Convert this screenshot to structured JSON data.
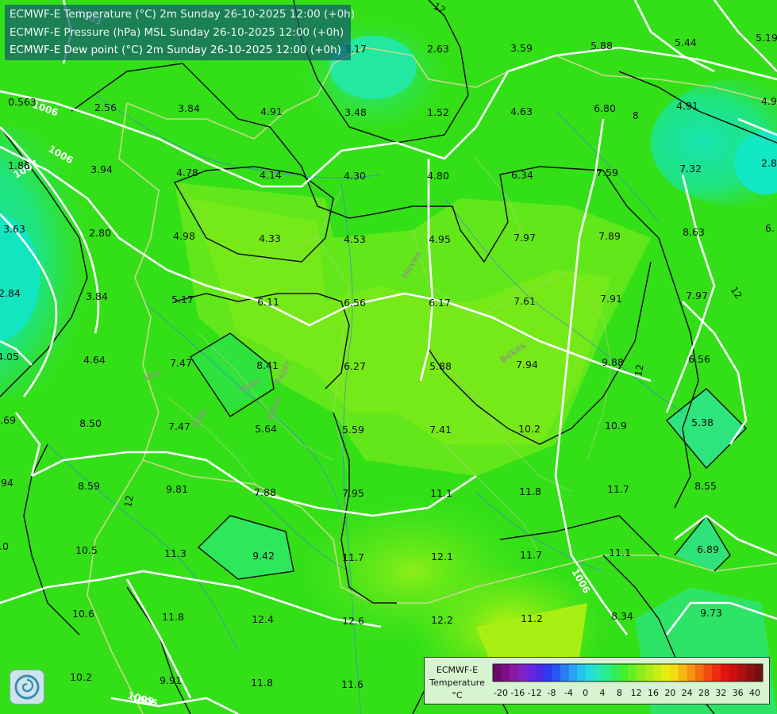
{
  "header": {
    "lines": [
      "ECMWF-E Temperature (°C) 2m Sunday 26-10-2025 12:00 (+0h)",
      "ECMWF-E Pressure (hPa) MSL Sunday 26-10-2025 12:00 (+0h)",
      "ECMWF-E Dew point (°C) 2m Sunday 26-10-2025 12:00 (+0h)"
    ]
  },
  "legend": {
    "title_lines": [
      "ECMWF-E",
      "Temperature",
      "°C"
    ],
    "ticks": [
      "-20",
      "-16",
      "-12",
      "-8",
      "-4",
      "0",
      "4",
      "8",
      "12",
      "16",
      "20",
      "24",
      "28",
      "32",
      "36",
      "40"
    ],
    "colors": [
      "#6a0a6a",
      "#7f0f86",
      "#8a1aa2",
      "#7e22c6",
      "#6a24dc",
      "#4c2ae6",
      "#2f38ee",
      "#2656f4",
      "#2a7cf6",
      "#2aa2f6",
      "#24c4ee",
      "#24dcd8",
      "#26e8b4",
      "#2aee8c",
      "#30ee5c",
      "#44ee2c",
      "#66ee22",
      "#88ee1c",
      "#a8ee18",
      "#c8ee14",
      "#e4ee10",
      "#f4dc10",
      "#f4b810",
      "#f49410",
      "#f46e10",
      "#f44a10",
      "#ee2a10",
      "#e21410",
      "#cc1010",
      "#b01010",
      "#901010",
      "#741010"
    ]
  },
  "isobar_labels": [
    "1003",
    "1005",
    "1006",
    "1006",
    "1007",
    "1006",
    "1005",
    "12",
    "12",
    "12",
    "12",
    "8"
  ],
  "region_labels": [
    "Heves",
    "Békés",
    "Vas",
    "Győr",
    "Fejér",
    "Tolna",
    "Zala"
  ],
  "values": [
    "0.563",
    "2.56",
    "3.84",
    "4.91",
    "3.48",
    "1.52",
    "4.63",
    "6.80",
    "4.91",
    "4.9",
    "3.17",
    "2.63",
    "3.59",
    "5.88",
    "5.44",
    "5.19",
    "1.86",
    "3.94",
    "4.78",
    "4.14",
    "4.30",
    "4.80",
    "6.34",
    "7.59",
    "7.32",
    "2.8",
    "3.63",
    "2.80",
    "4.98",
    "4.33",
    "4.53",
    "4.95",
    "7.97",
    "7.89",
    "8.63",
    "6.",
    "2.84",
    "3.84",
    "5.17",
    "6.11",
    "6.56",
    "6.17",
    "7.61",
    "7.91",
    "7.97",
    "4.05",
    "4.64",
    "7.47",
    "8.41",
    "6.27",
    "5.88",
    "7.94",
    "9.88",
    "6.56",
    ".69",
    "8.50",
    "7.47",
    "5.64",
    "5.59",
    "7.41",
    "10.2",
    "10.9",
    "5.38",
    ".94",
    "8.59",
    "9.81",
    "7.88",
    "7.95",
    "11.1",
    "11.8",
    "11.7",
    "8.55",
    ".0",
    "10.5",
    "11.3",
    "9.42",
    "11.7",
    "12.1",
    "11.7",
    "11.1",
    "6.89",
    "10.6",
    "11.8",
    "12.4",
    "12.6",
    "12.2",
    "11.2",
    "8.34",
    "9.73",
    "10.2",
    "9.91",
    "11.8",
    "11.6"
  ],
  "colors": {
    "field_base": "#33e018",
    "isobar": "#ffffff",
    "isotherm": "#111111",
    "border": "#c8d88a"
  }
}
